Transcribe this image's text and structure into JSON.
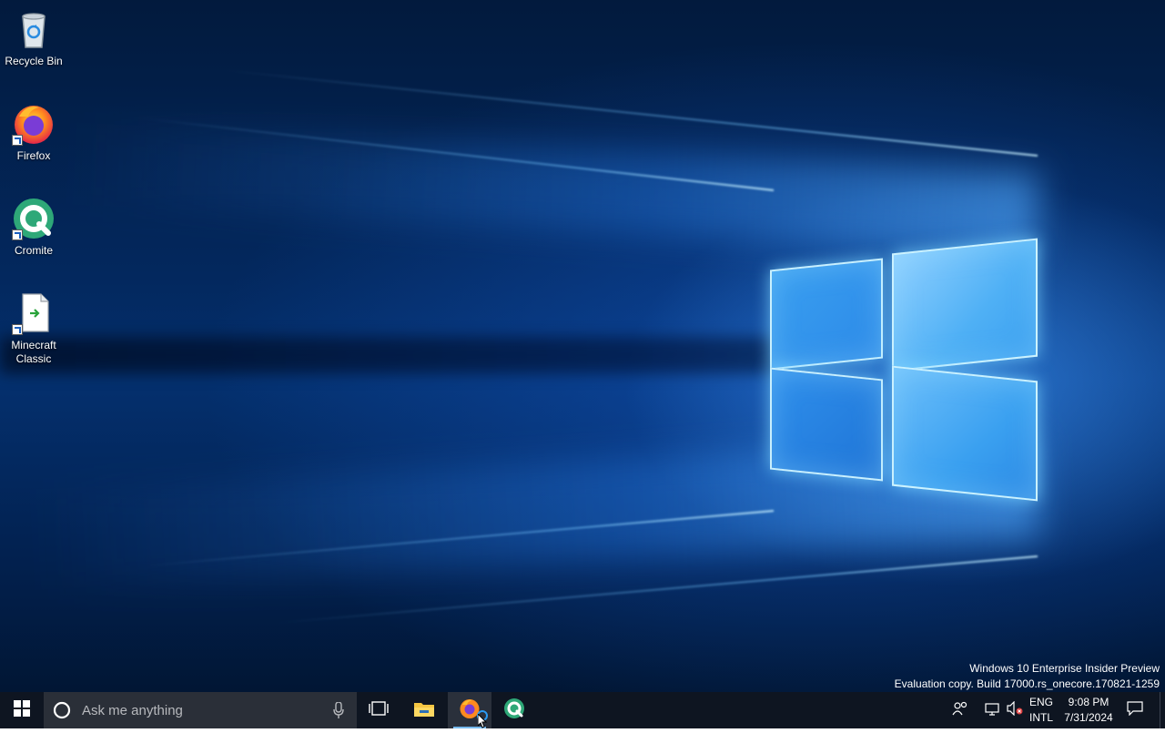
{
  "desktop": {
    "icons": [
      {
        "label": "Recycle Bin",
        "icon": "recycle-bin-icon"
      },
      {
        "label": "Firefox",
        "icon": "firefox-icon"
      },
      {
        "label": "Cromite",
        "icon": "cromite-icon"
      },
      {
        "label": "Minecraft Classic",
        "icon": "html-file-icon"
      }
    ],
    "watermark": {
      "line1": "Windows 10 Enterprise Insider Preview",
      "line2": "Evaluation copy. Build 17000.rs_onecore.170821-1259"
    }
  },
  "taskbar": {
    "start_icon": "windows-logo-icon",
    "search": {
      "placeholder": "Ask me anything",
      "icon": "cortana-circle-icon",
      "mic_icon": "microphone-icon"
    },
    "pinned": [
      {
        "name": "task-view",
        "icon": "task-view-icon"
      },
      {
        "name": "file-explorer",
        "icon": "folder-icon"
      },
      {
        "name": "firefox",
        "icon": "firefox-icon",
        "active": true
      },
      {
        "name": "cromite",
        "icon": "cromite-icon"
      }
    ],
    "tray": {
      "language_line1": "ENG",
      "language_line2": "INTL",
      "time": "9:08 PM",
      "date": "7/31/2024",
      "icons": [
        "people-icon",
        "network-icon",
        "volume-muted-icon",
        "notification-icon"
      ]
    }
  },
  "colors": {
    "taskbar_bg": "#0e1521",
    "search_bg": "#2a2f38",
    "accent": "#76b9ed",
    "wallpaper_blue": "#1f74d6"
  }
}
